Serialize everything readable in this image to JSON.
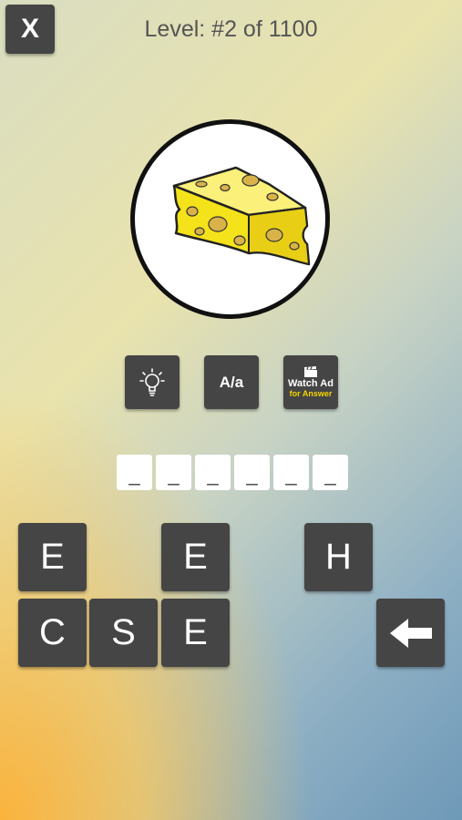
{
  "header": {
    "close_label": "X",
    "level_text": "Level: #2 of 1100"
  },
  "tools": {
    "hint_icon": "lightbulb-icon",
    "case_label": "A/a",
    "ad_line1": "Watch Ad",
    "ad_line2": "for Answer"
  },
  "answer_slots": [
    "_",
    "_",
    "_",
    "_",
    "_",
    "_"
  ],
  "letters": {
    "key1": "E",
    "key2": "E",
    "key3": "H",
    "key4": "C",
    "key5": "S",
    "key6": "E"
  },
  "backspace_icon": "arrow-left-icon",
  "colors": {
    "button_bg": "#454545",
    "cheese_yellow": "#f4e21a",
    "ad_text_yellow": "#f5d400"
  }
}
